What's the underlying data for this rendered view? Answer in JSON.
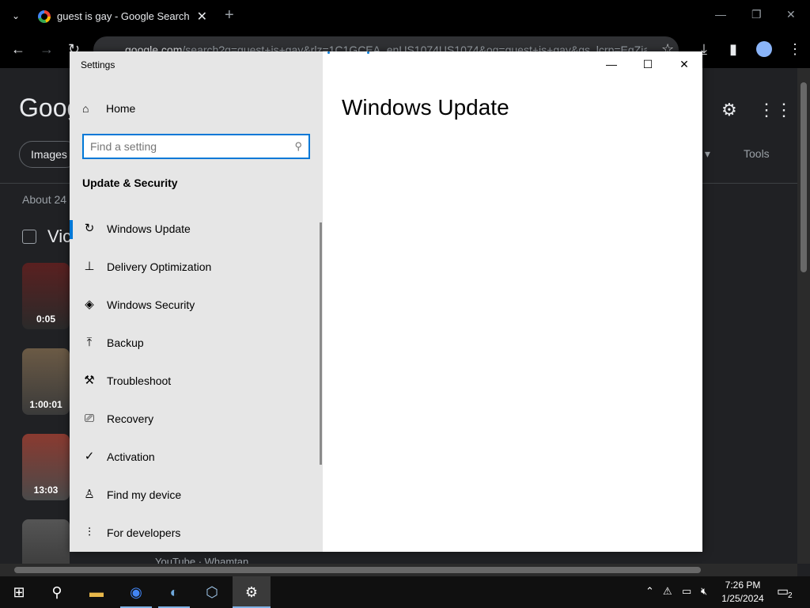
{
  "browser": {
    "tab_title": "guest is gay - Google Search",
    "url_host": "google.com",
    "url_rest": "/search?q=guest+is+gay&rlz=1C1GCEA_enUS1074US1074&oq=guest+is+gay&gs_lcrp=EgZja"
  },
  "google": {
    "logo_text": "Goog",
    "chip_images": "Images",
    "about_text": "About 24",
    "videos_heading": "Vic",
    "tools_label": "Tools",
    "filter_label": "s ▾",
    "thumbs": [
      {
        "duration": "0:05"
      },
      {
        "duration": "1:00:01"
      },
      {
        "duration": "13:03"
      },
      {
        "duration": ""
      }
    ],
    "bottom_text": "YouTube · Whamtan"
  },
  "settings": {
    "window_title": "Settings",
    "home_label": "Home",
    "search_placeholder": "Find a setting",
    "section_title": "Update & Security",
    "page_heading": "Windows Update",
    "nav_items": [
      {
        "label": "Windows Update",
        "icon": "refresh-icon"
      },
      {
        "label": "Delivery Optimization",
        "icon": "delivery-optimization-icon"
      },
      {
        "label": "Windows Security",
        "icon": "shield-icon"
      },
      {
        "label": "Backup",
        "icon": "backup-icon"
      },
      {
        "label": "Troubleshoot",
        "icon": "wrench-icon"
      },
      {
        "label": "Recovery",
        "icon": "recovery-icon"
      },
      {
        "label": "Activation",
        "icon": "check-circle-icon"
      },
      {
        "label": "Find my device",
        "icon": "find-device-icon"
      },
      {
        "label": "For developers",
        "icon": "developer-icon"
      }
    ]
  },
  "taskbar": {
    "time": "7:26 PM",
    "date": "1/25/2024",
    "notification_count": "2"
  }
}
